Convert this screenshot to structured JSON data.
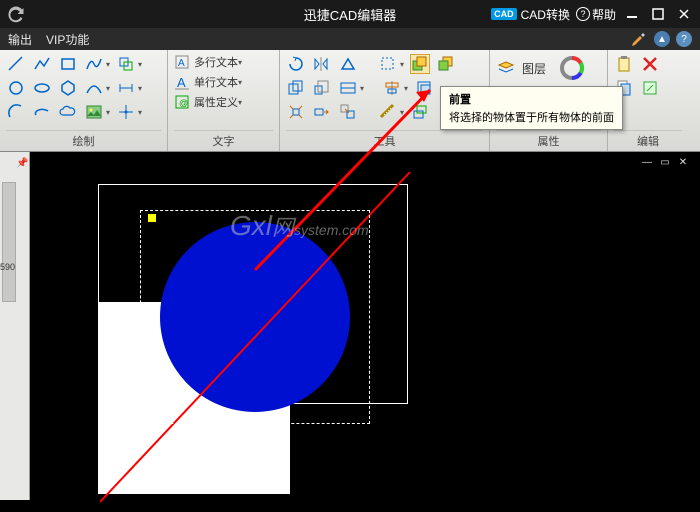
{
  "titlebar": {
    "app_title": "迅捷CAD编辑器",
    "cad_badge": "CAD",
    "cad_convert": "CAD转换",
    "help": "帮助"
  },
  "menubar": {
    "output": "输出",
    "vip": "VIP功能"
  },
  "ribbon": {
    "draw_label": "绘制",
    "text_label": "文字",
    "tools_label": "工具",
    "props_label": "属性",
    "edit_label": "编辑",
    "multiline_text": "多行文本",
    "singleline_text": "单行文本",
    "attr_define": "属性定义",
    "layer": "图层"
  },
  "tooltip": {
    "title": "前置",
    "desc": "将选择的物体置于所有物体的前面"
  },
  "panel": {
    "num": "590"
  },
  "watermark": {
    "main": "Gxl",
    "sub": "system.com",
    "net": "网"
  }
}
